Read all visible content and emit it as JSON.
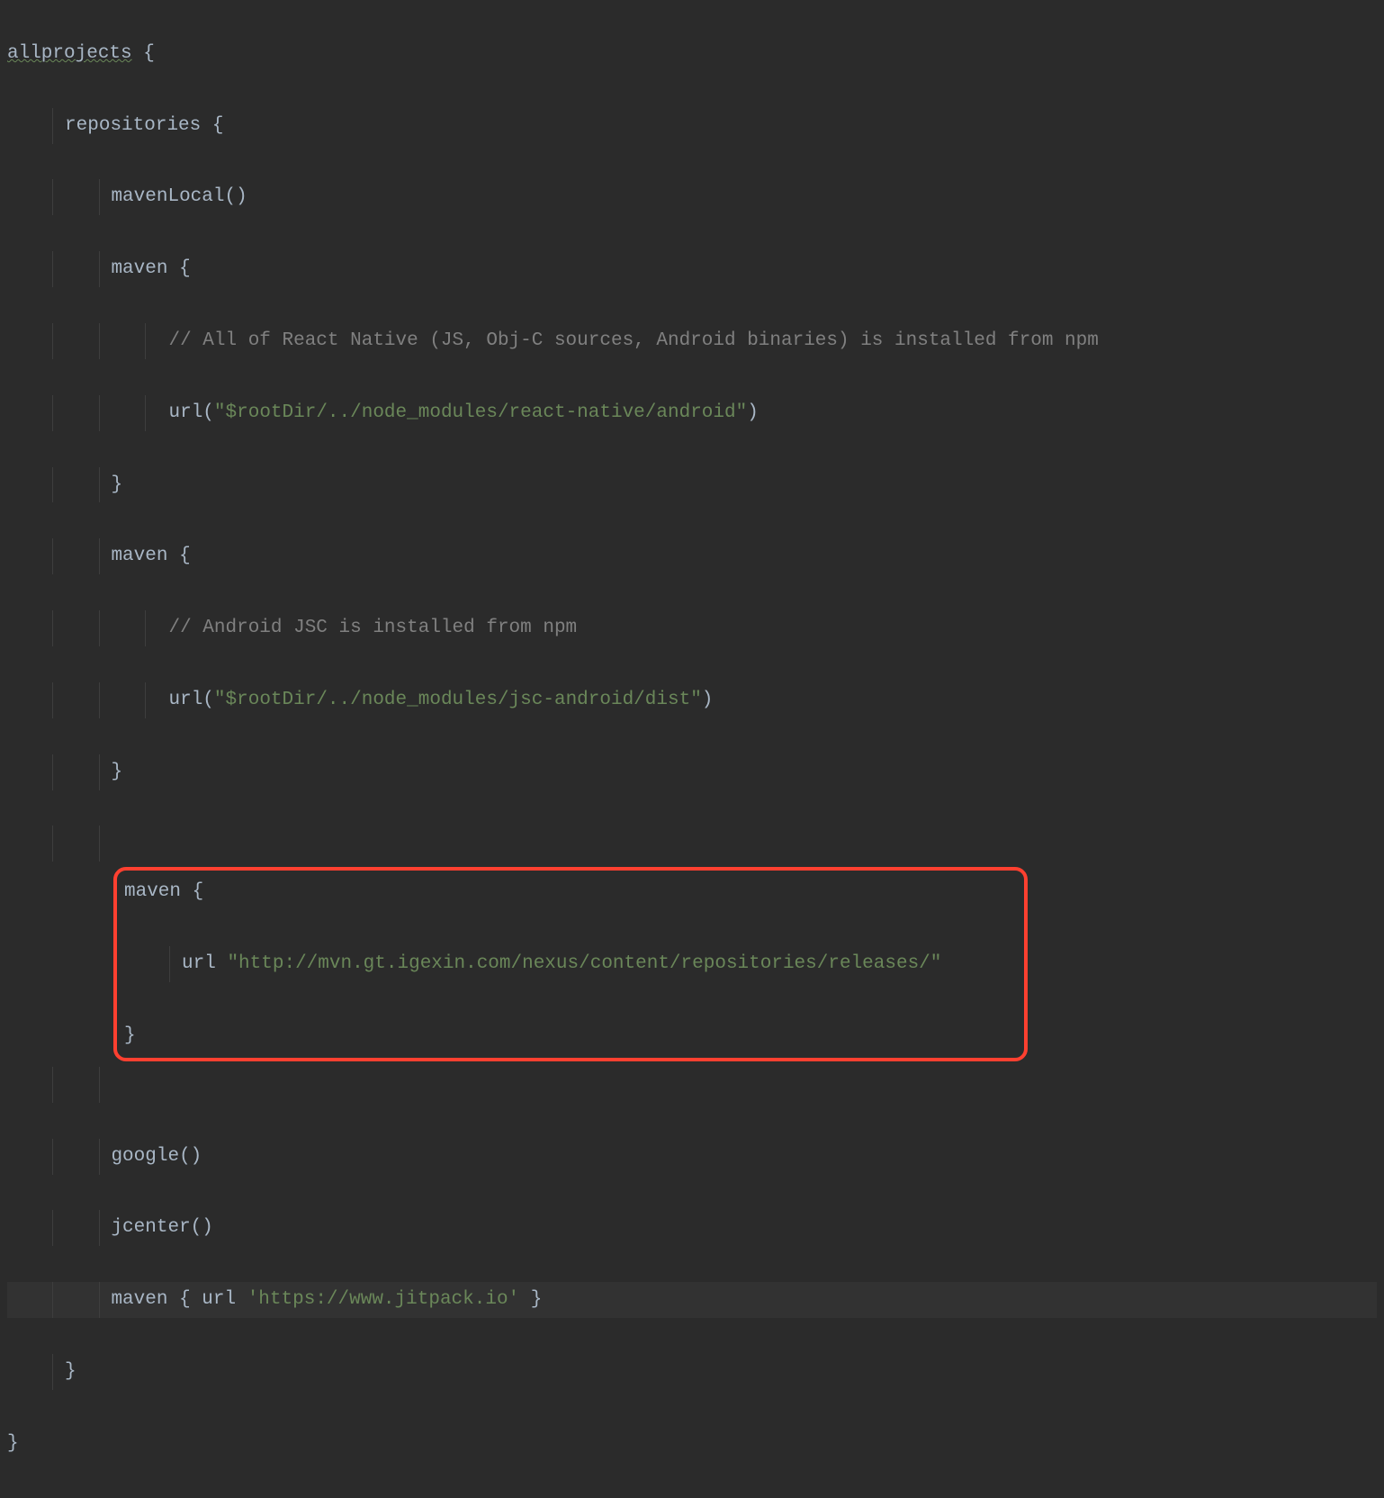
{
  "code": {
    "l1_allprojects": "allprojects",
    "l2_repositories": "repositories",
    "l3_mavenLocal": "mavenLocal",
    "l4_maven": "maven",
    "l5_comment": "// All of React Native (JS, Obj-C sources, Android binaries) is installed from npm",
    "l6_url": "url",
    "l6_string": "\"$rootDir/../node_modules/react-native/android\"",
    "l8_maven": "maven",
    "l9_comment": "// Android JSC is installed from npm",
    "l10_url": "url",
    "l10_string": "\"$rootDir/../node_modules/jsc-android/dist\"",
    "l13_maven": "maven",
    "l14_url": "url",
    "l14_string": "\"http://mvn.gt.igexin.com/nexus/content/repositories/releases/\"",
    "l17_google": "google",
    "l18_jcenter": "jcenter",
    "l19_maven": "maven",
    "l19_url": "url",
    "l19_string": "'https://www.jitpack.io'"
  }
}
